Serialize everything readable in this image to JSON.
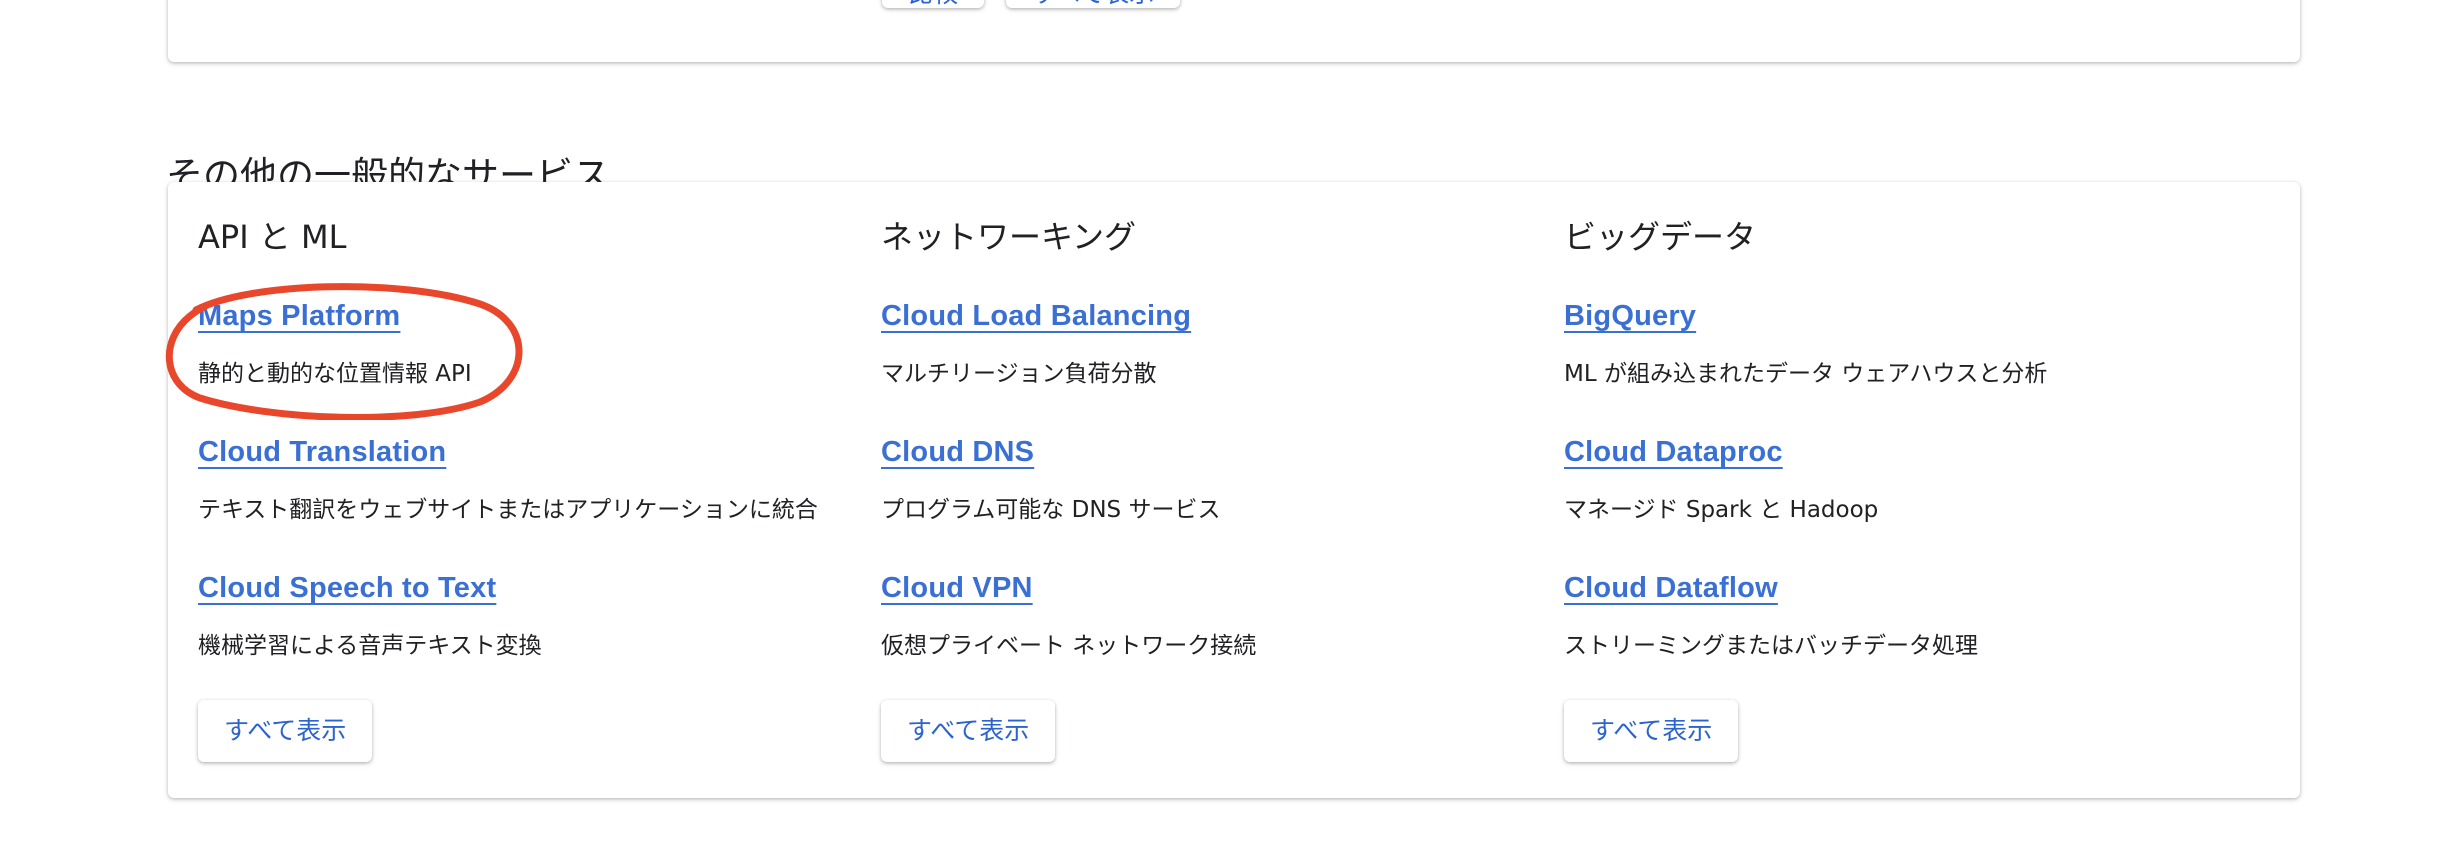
{
  "top_card": {
    "compare_label": "比較",
    "view_all_label": "すべて表示"
  },
  "section": {
    "title": "その他の一般的なサービス"
  },
  "columns": [
    {
      "title": "API と ML",
      "items": [
        {
          "name": "Maps Platform",
          "desc": "静的と動的な位置情報 API"
        },
        {
          "name": "Cloud Translation",
          "desc": "テキスト翻訳をウェブサイトまたはアプリケーションに統合"
        },
        {
          "name": "Cloud Speech to Text",
          "desc": "機械学習による音声テキスト変換"
        }
      ],
      "view_all_label": "すべて表示"
    },
    {
      "title": "ネットワーキング",
      "items": [
        {
          "name": "Cloud Load Balancing",
          "desc": "マルチリージョン負荷分散"
        },
        {
          "name": "Cloud DNS",
          "desc": "プログラム可能な DNS サービス"
        },
        {
          "name": "Cloud VPN",
          "desc": "仮想プライベート ネットワーク接続"
        }
      ],
      "view_all_label": "すべて表示"
    },
    {
      "title": "ビッグデータ",
      "items": [
        {
          "name": "BigQuery",
          "desc": "ML が組み込まれたデータ ウェアハウスと分析"
        },
        {
          "name": "Cloud Dataproc",
          "desc": "マネージド Spark と Hadoop"
        },
        {
          "name": "Cloud Dataflow",
          "desc": "ストリーミングまたはバッチデータ処理"
        }
      ],
      "view_all_label": "すべて表示"
    }
  ],
  "colors": {
    "link": "#3a6fd4",
    "annotation": "#e8472b"
  }
}
